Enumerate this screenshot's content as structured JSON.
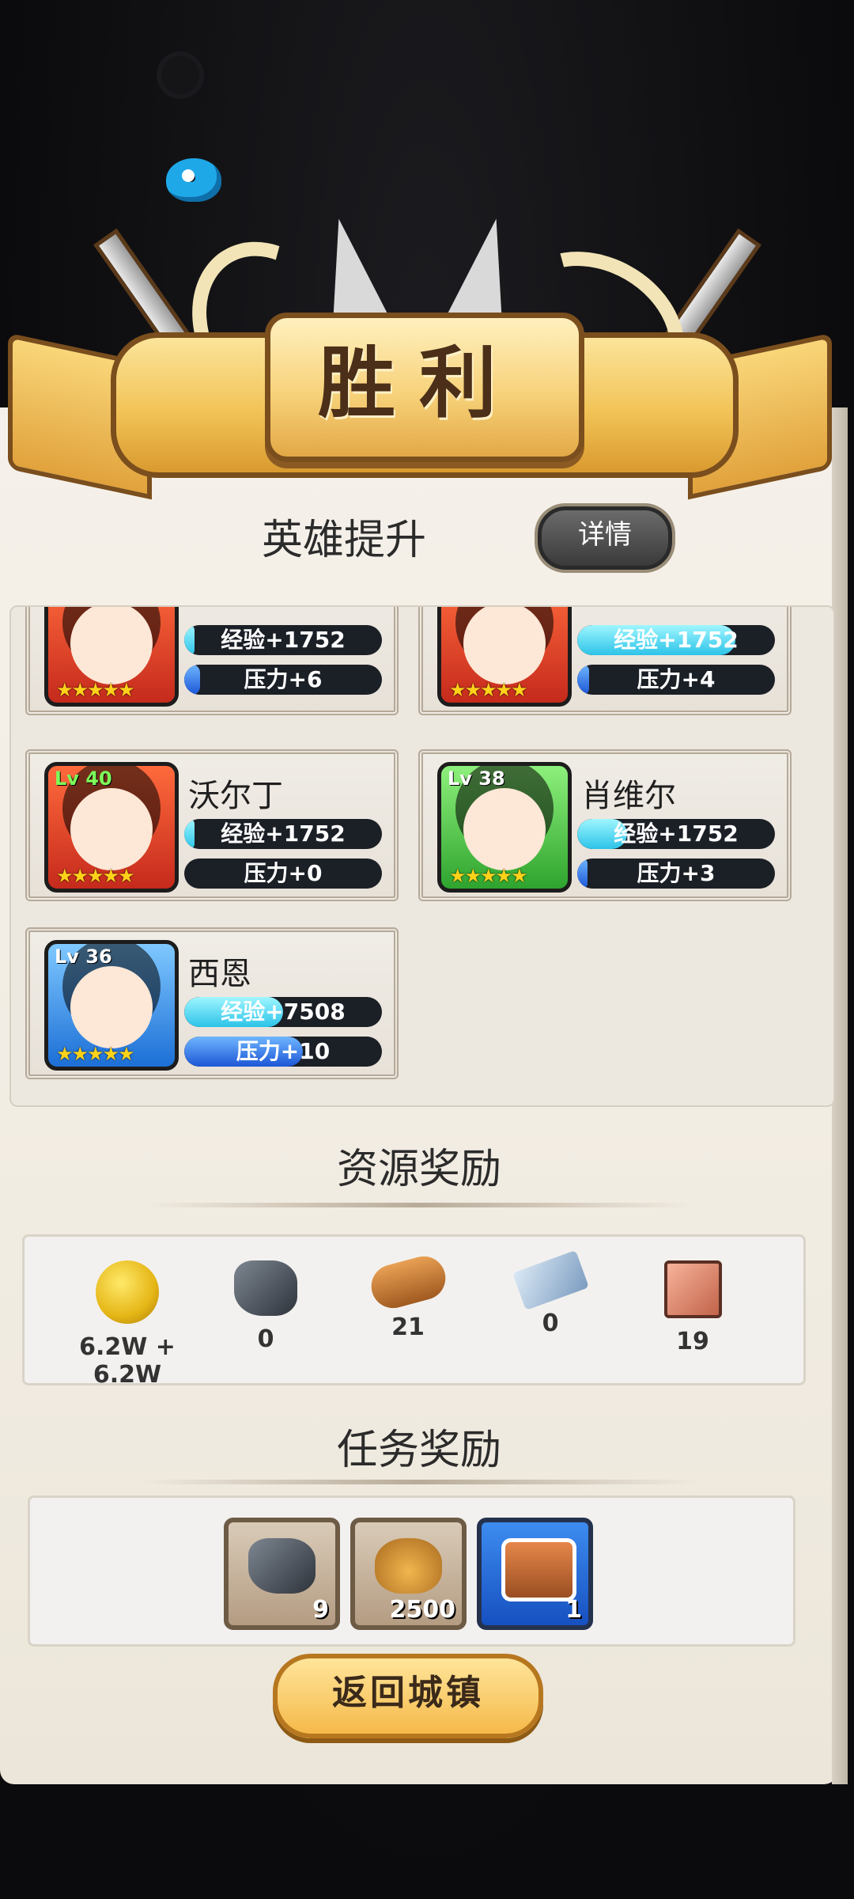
{
  "banner": {
    "title": "胜利"
  },
  "hero_section": {
    "title": "英雄提升",
    "detail_button": "详情"
  },
  "heroes": [
    {
      "name": "",
      "level": "",
      "stars": "★★★★★",
      "exp_label": "经验+1752",
      "exp_fill": 0.05,
      "pressure_label": "压力+6",
      "pressure_fill": 0.08,
      "frame": "red"
    },
    {
      "name": "",
      "level": "",
      "stars": "★★★★★",
      "exp_label": "经验+1752",
      "exp_fill": 0.8,
      "pressure_label": "压力+4",
      "pressure_fill": 0.06,
      "frame": "red"
    },
    {
      "name": "沃尔丁",
      "level": "Lv 40",
      "stars": "★★★★★",
      "exp_label": "经验+1752",
      "exp_fill": 0.05,
      "pressure_label": "压力+0",
      "pressure_fill": 0.0,
      "frame": "red"
    },
    {
      "name": "肖维尔",
      "level": "Lv 38",
      "stars": "★★★★★",
      "exp_label": "经验+1752",
      "exp_fill": 0.25,
      "pressure_label": "压力+3",
      "pressure_fill": 0.05,
      "frame": "green"
    },
    {
      "name": "西恩",
      "level": "Lv 36",
      "stars": "★★★★★",
      "exp_label": "经验+7508",
      "exp_fill": 0.5,
      "pressure_label": "压力+10",
      "pressure_fill": 0.6,
      "frame": "blue"
    }
  ],
  "resource_section": {
    "title": "资源奖励",
    "items": [
      {
        "icon": "gold-coin-icon",
        "value": "6.2W + 6.2W"
      },
      {
        "icon": "ore-icon",
        "value": "0"
      },
      {
        "icon": "wood-log-icon",
        "value": "21"
      },
      {
        "icon": "cloth-icon",
        "value": "0"
      },
      {
        "icon": "meat-icon",
        "value": "19"
      }
    ]
  },
  "task_section": {
    "title": "任务奖励",
    "rewards": [
      {
        "icon": "ore-icon",
        "count": "9"
      },
      {
        "icon": "money-bag-icon",
        "count": "2500"
      },
      {
        "icon": "treasure-chest-icon",
        "count": "1"
      }
    ]
  },
  "return_button": "返回城镇",
  "colors": {
    "gold": "#f5b94a",
    "exp_bar": "#2cc3e8",
    "pressure_bar": "#1c56d6",
    "panel": "#f5f1ea"
  }
}
